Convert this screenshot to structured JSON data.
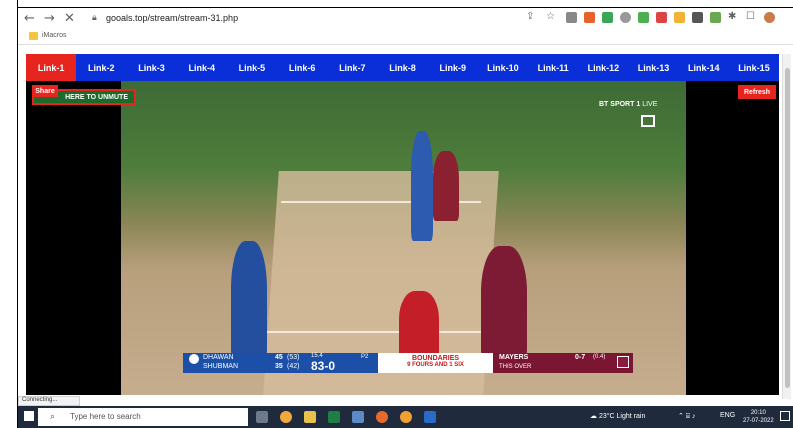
{
  "browser": {
    "url": "gooals.top/stream/stream-31.php",
    "bookmark_label": "iMacros"
  },
  "links": [
    "Link-1",
    "Link-2",
    "Link-3",
    "Link-4",
    "Link-5",
    "Link-6",
    "Link-7",
    "Link-8",
    "Link-9",
    "Link-10",
    "Link-11",
    "Link-12",
    "Link-13",
    "Link-14",
    "Link-15"
  ],
  "controls": {
    "share": "Share",
    "unmute": "HERE TO UNMUTE",
    "refresh": "Refresh"
  },
  "broadcast": {
    "channel": "BT SPORT 1",
    "live": "LIVE"
  },
  "scoreboard": {
    "batter1": "DHAWAN",
    "batter1_score": "45",
    "batter1_balls": "(53)",
    "batter2": "SHUBMAN",
    "batter2_score": "35",
    "batter2_balls": "(42)",
    "overs": "15.4",
    "total": "83-0",
    "pp": "P2",
    "mid_title": "BOUNDARIES",
    "mid_sub": "9 FOURS AND 1 SIX",
    "bowler": "MAYERS",
    "bowler_figs": "0-7",
    "bowler_overs": "(0.4)",
    "this_over": "THIS OVER"
  },
  "status": "Connecting...",
  "taskbar": {
    "search_placeholder": "Type here to search",
    "weather": "23°C  Light rain",
    "lang": "ENG",
    "time": "20:10",
    "date": "27-07-2022"
  },
  "colors": {
    "link_bar": "#0a2fd8",
    "link_active": "#e8241f",
    "taskbar": "#1f2b3d"
  }
}
